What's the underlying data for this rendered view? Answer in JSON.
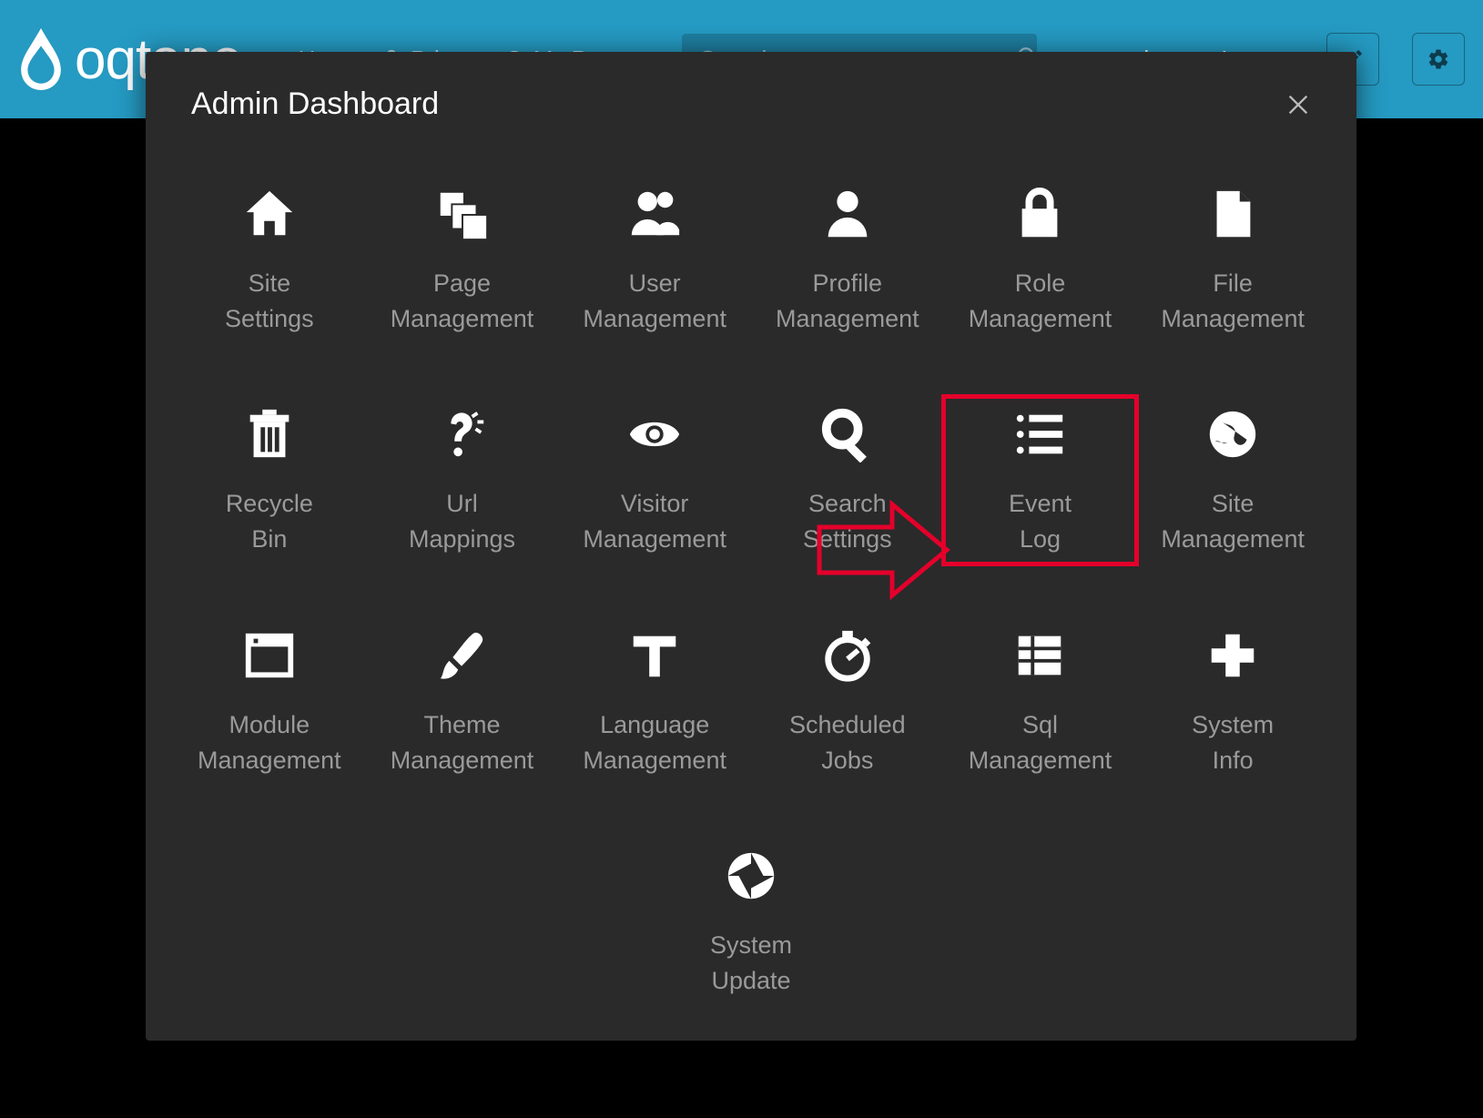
{
  "topbar": {
    "brand": "oqtane",
    "nav": [
      {
        "label": "Home",
        "icon": "home"
      },
      {
        "label": "Private",
        "icon": "lock"
      },
      {
        "label": "My Page",
        "icon": "target"
      }
    ],
    "search_placeholder": "Search",
    "user_label": "host",
    "logout_label": "Logout"
  },
  "modal": {
    "title": "Admin Dashboard",
    "highlighted": "event-log",
    "tiles": [
      {
        "id": "site-settings",
        "label": "Site\nSettings",
        "icon": "home"
      },
      {
        "id": "page-management",
        "label": "Page\nManagement",
        "icon": "pages"
      },
      {
        "id": "user-management",
        "label": "User\nManagement",
        "icon": "users"
      },
      {
        "id": "profile-management",
        "label": "Profile\nManagement",
        "icon": "user"
      },
      {
        "id": "role-management",
        "label": "Role\nManagement",
        "icon": "lock"
      },
      {
        "id": "file-management",
        "label": "File\nManagement",
        "icon": "file"
      },
      {
        "id": "recycle-bin",
        "label": "Recycle\nBin",
        "icon": "trash"
      },
      {
        "id": "url-mappings",
        "label": "Url\nMappings",
        "icon": "question"
      },
      {
        "id": "visitor-management",
        "label": "Visitor\nManagement",
        "icon": "eye"
      },
      {
        "id": "search-settings",
        "label": "Search\nSettings",
        "icon": "search"
      },
      {
        "id": "event-log",
        "label": "Event\nLog",
        "icon": "list"
      },
      {
        "id": "site-management",
        "label": "Site\nManagement",
        "icon": "globe"
      },
      {
        "id": "module-management",
        "label": "Module\nManagement",
        "icon": "window"
      },
      {
        "id": "theme-management",
        "label": "Theme\nManagement",
        "icon": "brush"
      },
      {
        "id": "language-management",
        "label": "Language\nManagement",
        "icon": "font"
      },
      {
        "id": "scheduled-jobs",
        "label": "Scheduled\nJobs",
        "icon": "timer"
      },
      {
        "id": "sql-management",
        "label": "Sql\nManagement",
        "icon": "table"
      },
      {
        "id": "system-info",
        "label": "System\nInfo",
        "icon": "plus"
      },
      {
        "id": "system-update",
        "label": "System\nUpdate",
        "icon": "aperture"
      }
    ]
  },
  "colors": {
    "accent": "#259ac2",
    "modal_bg": "#2a2a2a",
    "highlight": "#e4002b"
  }
}
